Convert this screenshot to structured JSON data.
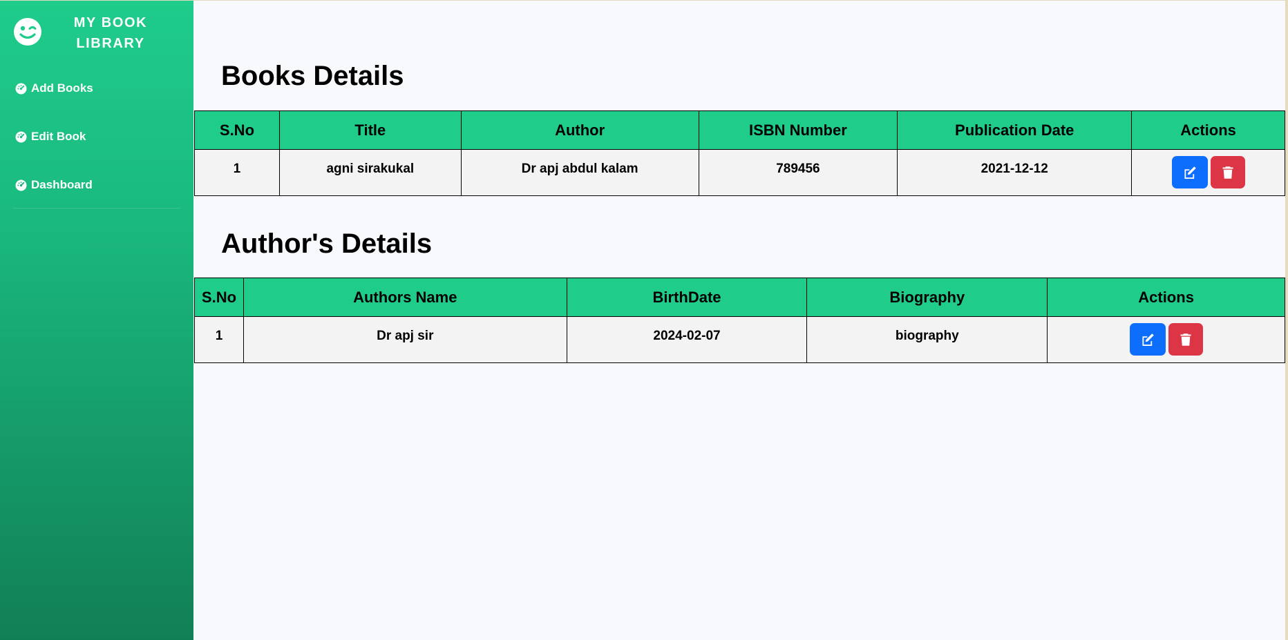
{
  "brand": {
    "title": "MY BOOK LIBRARY",
    "icon": "wink-emoji-icon"
  },
  "sidebar": {
    "items": [
      {
        "label": "Add Books",
        "icon": "speedometer-icon"
      },
      {
        "label": "Edit Book",
        "icon": "speedometer-icon"
      },
      {
        "label": "Dashboard",
        "icon": "speedometer-icon"
      }
    ]
  },
  "books": {
    "title": "Books Details",
    "columns": [
      "S.No",
      "Title",
      "Author",
      "ISBN Number",
      "Publication Date",
      "Actions"
    ],
    "rows": [
      {
        "sno": "1",
        "title": "agni sirakukal",
        "author": "Dr apj abdul kalam",
        "isbn": "789456",
        "date": "2021-12-12"
      }
    ]
  },
  "authors": {
    "title": "Author's Details",
    "columns": [
      "S.No",
      "Authors Name",
      "BirthDate",
      "Biography",
      "Actions"
    ],
    "rows": [
      {
        "sno": "1",
        "name": "Dr apj sir",
        "birthdate": "2024-02-07",
        "biography": "biography"
      }
    ]
  },
  "colors": {
    "sidebar_top": "#1fcc8b",
    "sidebar_bottom": "#117f55",
    "table_header": "#20cc8a",
    "edit_button": "#0d6efd",
    "delete_button": "#dc3545"
  }
}
